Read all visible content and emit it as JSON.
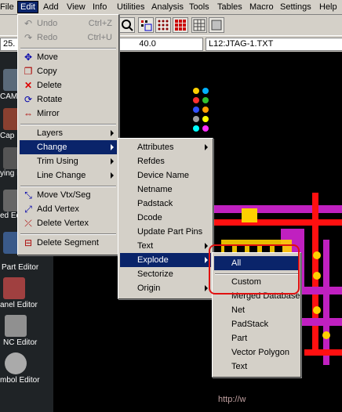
{
  "menubar": [
    "File",
    "Edit",
    "Add",
    "View",
    "Info",
    "Utilities",
    "Analysis",
    "Tools",
    "Tables",
    "Macro",
    "Settings",
    "Help"
  ],
  "toolbar": {
    "field_left": "25.",
    "field_mid": "40.0",
    "field_right": "L12:JTAG-1.TXT",
    "tab_left": "ort"
  },
  "left_panel": [
    "CAM",
    "Cap",
    "ying Ed",
    "ed Ed",
    "Part Editor",
    "anel Editor",
    "NC Editor",
    "mbol Editor"
  ],
  "edit_menu": {
    "undo": "Undo",
    "undo_sc": "Ctrl+Z",
    "redo": "Redo",
    "redo_sc": "Ctrl+U",
    "move": "Move",
    "copy": "Copy",
    "delete": "Delete",
    "rotate": "Rotate",
    "mirror": "Mirror",
    "layers": "Layers",
    "change": "Change",
    "trim_using": "Trim Using",
    "line_change": "Line Change",
    "move_vtx": "Move Vtx/Seg",
    "add_vertex": "Add Vertex",
    "delete_vertex": "Delete Vertex",
    "delete_segment": "Delete Segment"
  },
  "change_menu": [
    "Attributes",
    "Refdes",
    "Device Name",
    "Netname",
    "Padstack",
    "Dcode",
    "Update Part Pins",
    "Text",
    "Explode",
    "Sectorize",
    "Origin"
  ],
  "explode_menu": [
    "All",
    "Custom",
    "Merged Database",
    "Net",
    "PadStack",
    "Part",
    "Vector Polygon",
    "Text"
  ],
  "watermark": "http://w",
  "colors": {
    "menu_bg": "#d4d0c8",
    "highlight": "#0a246a",
    "annotation": "#e01010",
    "trace": "#c020c0"
  }
}
